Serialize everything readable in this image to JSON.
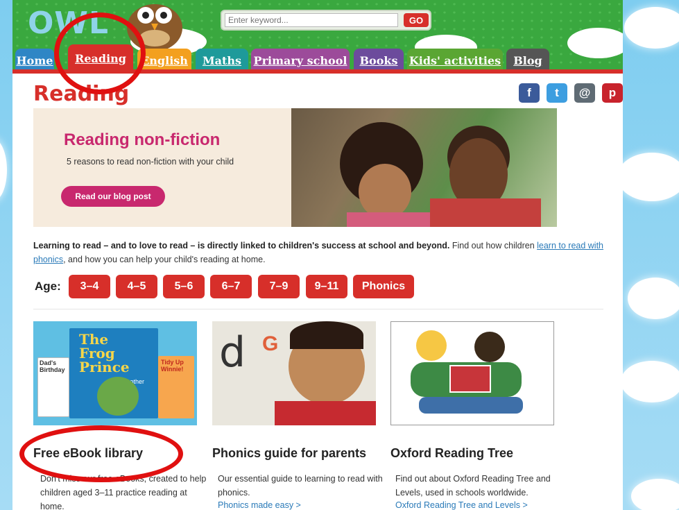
{
  "site": {
    "logo_text": "OWL"
  },
  "search": {
    "placeholder": "Enter keyword...",
    "go_label": "GO"
  },
  "nav": {
    "tabs": [
      {
        "label": "Home",
        "color": "#2f86c5"
      },
      {
        "label": "Reading",
        "color": "#d72f2a"
      },
      {
        "label": "English",
        "color": "#f3a01f"
      },
      {
        "label": "Maths",
        "color": "#1e9a9a"
      },
      {
        "label": "Primary school",
        "color": "#9c4b9a"
      },
      {
        "label": "Books",
        "color": "#6c4b9c"
      },
      {
        "label": "Kids' activities",
        "color": "#5aa633"
      },
      {
        "label": "Blog",
        "color": "#555555"
      }
    ]
  },
  "page": {
    "title": "Reading"
  },
  "social": [
    "f",
    "t",
    "@",
    "p"
  ],
  "hero": {
    "title": "Reading non-fiction",
    "subtitle": "5 reasons to read non-fiction with your child",
    "button": "Read our blog post"
  },
  "intro": {
    "bold": "Learning to read – and to love to read – is directly linked to children's success at school and beyond.",
    "text1": " Find out how children ",
    "link": "learn to read with phonics",
    "text2": ", and how you can help your child's reading at home."
  },
  "age": {
    "label": "Age:",
    "options": [
      "3–4",
      "4–5",
      "5–6",
      "6–7",
      "7–9",
      "9–11",
      "Phonics"
    ]
  },
  "cards": [
    {
      "title": "Free eBook library",
      "desc": "Don't miss our free eBooks, created to help children aged 3–11 practice reading at home.",
      "link": ""
    },
    {
      "title": "Phonics guide for parents",
      "desc": "Our essential guide to learning to read with phonics.",
      "link": "Phonics made easy >"
    },
    {
      "title": "Oxford Reading Tree",
      "desc": "Find out about Oxford Reading Tree and Levels, used in schools worldwide.",
      "link": "Oxford Reading Tree and Levels >"
    }
  ],
  "book_covers": {
    "frog_title": "The Frog Prince",
    "frog_sub": "and other tales",
    "left_book": "Dad's Birthday",
    "right_book": "Tidy Up Winnie!"
  },
  "phonics_letters": {
    "a": "d",
    "b": "G"
  }
}
